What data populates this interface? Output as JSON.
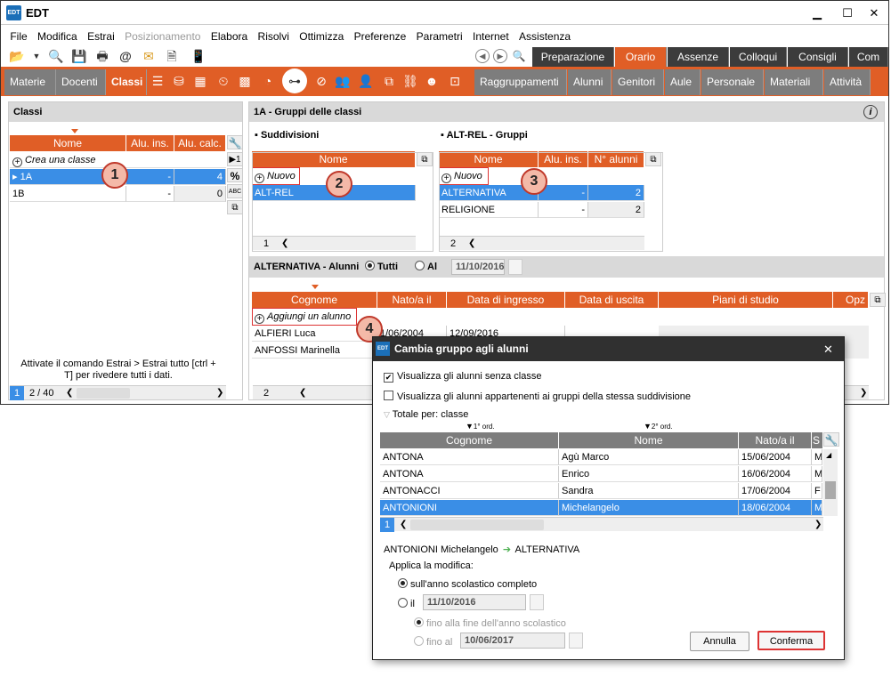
{
  "window": {
    "title": "EDT",
    "min": "▁",
    "max": "☐",
    "close": "✕",
    "app_icon": "EDT"
  },
  "menu": [
    "File",
    "Modifica",
    "Estrai",
    "Posizionamento",
    "Elabora",
    "Risolvi",
    "Ottimizza",
    "Preferenze",
    "Parametri",
    "Internet",
    "Assistenza"
  ],
  "mode_tabs": [
    "Preparazione",
    "Orario",
    "Assenze",
    "Colloqui",
    "Consigli",
    "Com"
  ],
  "nav_tabs_left": [
    "Materie",
    "Docenti",
    "Classi"
  ],
  "nav_tabs_right": [
    "Raggruppamenti",
    "Alunni",
    "Genitori",
    "Aule",
    "Personale",
    "Materiali",
    "Attività"
  ],
  "classi": {
    "title": "Classi",
    "headers": [
      "Nome",
      "Alu. ins.",
      "Alu. calc."
    ],
    "add_label": "Crea una classe",
    "rows": [
      {
        "name": "1A",
        "ins": "-",
        "calc": "4"
      },
      {
        "name": "1B",
        "ins": "-",
        "calc": "0"
      }
    ],
    "hint": "Attivate il comando Estrai > Estrai tutto [ctrl + T] per rivedere tutti i dati.",
    "footer_sel": "1",
    "footer_count": "2 / 40",
    "side_buttons": [
      "▶1",
      "%",
      "ABC"
    ]
  },
  "gruppi": {
    "title": "1A - Gruppi delle classi",
    "suddivisioni_title": "Suddivisioni",
    "suddivisioni_header": "Nome",
    "suddivisioni_add": "Nuovo",
    "suddivisioni_rows": [
      "ALT-REL"
    ],
    "suddivisioni_footer": "1",
    "altrel_title": "ALT-REL - Gruppi",
    "altrel_headers": [
      "Nome",
      "Alu. ins.",
      "N° alunni"
    ],
    "altrel_add": "Nuovo",
    "altrel_rows": [
      {
        "name": "ALTERNATIVA",
        "ins": "-",
        "n": "2"
      },
      {
        "name": "RELIGIONE",
        "ins": "-",
        "n": "2"
      }
    ],
    "altrel_footer": "2"
  },
  "alunni": {
    "title": "ALTERNATIVA - Alunni",
    "radio_all": "Tutti",
    "radio_at": "Al",
    "date": "11/10/2016",
    "headers": [
      "Cognome",
      "Nato/a il",
      "Data di ingresso",
      "Data di uscita",
      "Piani di studio",
      "Opz"
    ],
    "add_label": "Aggiungi un alunno",
    "rows": [
      {
        "name": "ALFIERI Luca",
        "born": "1/06/2004",
        "in": "12/09/2016"
      },
      {
        "name": "ANFOSSI Marinella",
        "born": "",
        "in": ""
      }
    ],
    "footer": "2"
  },
  "callouts": [
    "1",
    "2",
    "3",
    "4"
  ],
  "dialog": {
    "title": "Cambia gruppo agli alunni",
    "chk1": "Visualizza gli alunni senza classe",
    "chk2": "Visualizza gli alunni appartenenti ai gruppi della stessa suddivisione",
    "totale": "Totale per: classe",
    "sort1": "1° ord.",
    "sort2": "2° ord.",
    "headers": [
      "Cognome",
      "Nome",
      "Nato/a il",
      "S"
    ],
    "rows": [
      {
        "c": "ANTONA",
        "n": "Agù Marco",
        "d": "15/06/2004",
        "s": "M"
      },
      {
        "c": "ANTONA",
        "n": "Enrico",
        "d": "16/06/2004",
        "s": "M"
      },
      {
        "c": "ANTONACCI",
        "n": "Sandra",
        "d": "17/06/2004",
        "s": "F"
      },
      {
        "c": "ANTONIONI",
        "n": "Michelangelo",
        "d": "18/06/2004",
        "s": "M"
      }
    ],
    "footer": "1",
    "move_from": "ANTONIONI Michelangelo",
    "move_to": "ALTERNATIVA",
    "applica": "Applica la modifica:",
    "opt_full": "sull'anno scolastico completo",
    "opt_il": "il",
    "date1": "11/10/2016",
    "opt_end": "fino alla fine dell'anno scolastico",
    "opt_al": "fino al",
    "date2": "10/06/2017",
    "cancel": "Annulla",
    "confirm": "Conferma"
  },
  "colors": {
    "accent": "#e05e26",
    "selection": "#3a8ee6",
    "dark": "#3c3c3c",
    "callout": "#f4b9a8"
  }
}
